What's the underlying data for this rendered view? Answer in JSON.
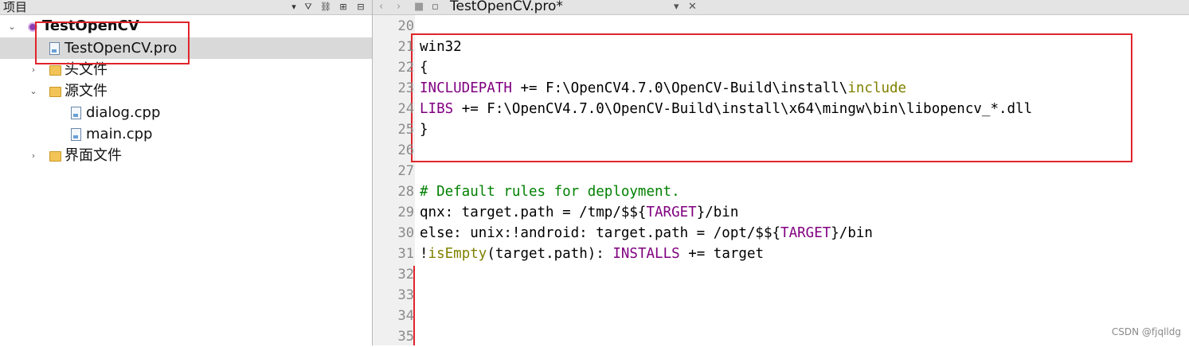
{
  "project_panel": {
    "title": "项目",
    "tree": [
      {
        "label": "TestOpenCV",
        "bold": true
      },
      {
        "label": "TestOpenCV.pro",
        "selected": true
      },
      {
        "label": "头文件"
      },
      {
        "label": "源文件"
      },
      {
        "label": "dialog.cpp"
      },
      {
        "label": "main.cpp"
      },
      {
        "label": "界面文件"
      }
    ]
  },
  "editor": {
    "tab_title": "TestOpenCV.pro*",
    "lines": [
      {
        "num": "20",
        "parts": []
      },
      {
        "num": "21",
        "parts": [
          {
            "t": "win32",
            "c": ""
          }
        ]
      },
      {
        "num": "22",
        "parts": [
          {
            "t": "{",
            "c": ""
          }
        ]
      },
      {
        "num": "23",
        "parts": [
          {
            "t": "INCLUDEPATH",
            "c": "kw"
          },
          {
            "t": " += F:\\OpenCV4.7.0\\OpenCV-Build\\install\\",
            "c": ""
          },
          {
            "t": "include",
            "c": "ol"
          }
        ]
      },
      {
        "num": "24",
        "parts": [
          {
            "t": "LIBS",
            "c": "kw"
          },
          {
            "t": " += F:\\OpenCV4.7.0\\OpenCV-Build\\install\\x64\\mingw\\bin\\libopencv_*.dll",
            "c": ""
          }
        ]
      },
      {
        "num": "25",
        "parts": [
          {
            "t": "}",
            "c": ""
          }
        ]
      },
      {
        "num": "26",
        "parts": []
      },
      {
        "num": "27",
        "parts": []
      },
      {
        "num": "28",
        "parts": [
          {
            "t": "# Default rules for deployment.",
            "c": "cm"
          }
        ]
      },
      {
        "num": "29",
        "parts": [
          {
            "t": "qnx: target.path = /tmp/$${",
            "c": ""
          },
          {
            "t": "TARGET",
            "c": "kw"
          },
          {
            "t": "}/bin",
            "c": ""
          }
        ]
      },
      {
        "num": "30",
        "parts": [
          {
            "t": "else: unix:!android: target.path = /opt/$${",
            "c": ""
          },
          {
            "t": "TARGET",
            "c": "kw"
          },
          {
            "t": "}/bin",
            "c": ""
          }
        ]
      },
      {
        "num": "31",
        "parts": [
          {
            "t": "!",
            "c": ""
          },
          {
            "t": "isEmpty",
            "c": "ol"
          },
          {
            "t": "(target.path): ",
            "c": ""
          },
          {
            "t": "INSTALLS",
            "c": "kw"
          },
          {
            "t": " += target",
            "c": ""
          }
        ]
      },
      {
        "num": "32",
        "parts": []
      },
      {
        "num": "33",
        "parts": []
      },
      {
        "num": "34",
        "parts": []
      },
      {
        "num": "35",
        "parts": []
      }
    ]
  },
  "watermark": "CSDN @fjqlldg",
  "colors": {
    "annotation": "#e0252b",
    "keyword": "#800080",
    "builtin": "#808000",
    "comment": "#008000"
  }
}
